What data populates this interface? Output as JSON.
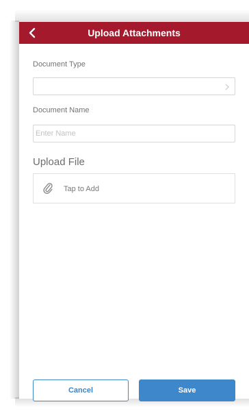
{
  "header": {
    "title": "Upload Attachments",
    "back_icon": "chevron-left-icon",
    "background": "#a41a2c"
  },
  "form": {
    "document_type": {
      "label": "Document Type",
      "value": "",
      "icon": "chevron-right-icon"
    },
    "document_name": {
      "label": "Document Name",
      "placeholder": "Enter Name",
      "value": ""
    },
    "upload_file": {
      "label": "Upload File",
      "action_text": "Tap to Add",
      "icon": "paperclip-icon"
    }
  },
  "footer": {
    "cancel_label": "Cancel",
    "save_label": "Save",
    "accent": "#3f87cb"
  }
}
